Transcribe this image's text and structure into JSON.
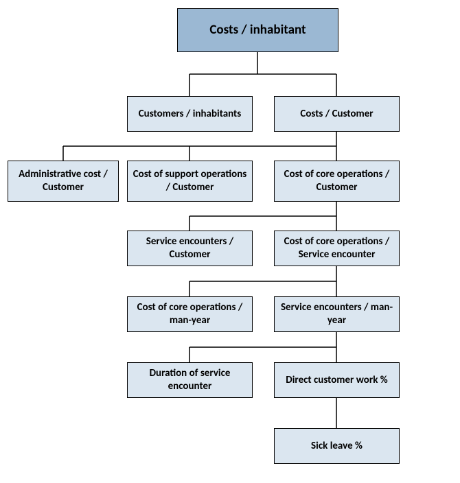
{
  "nodes": {
    "top": "Costs / inhabitant",
    "r2a": "Customers / inhabitants",
    "r2b": "Costs / Customer",
    "r3a": "Administrative cost / Customer",
    "r3b": "Cost of support operations / Customer",
    "r3c": "Cost of core operations / Customer",
    "r4a": "Service encounters / Customer",
    "r4b": "Cost of core operations / Service encounter",
    "r5a": "Cost of core operations / man-year",
    "r5b": "Service encounters / man-year",
    "r6a": "Duration of service encounter",
    "r6b": "Direct customer work %",
    "r7": "Sick leave %"
  }
}
